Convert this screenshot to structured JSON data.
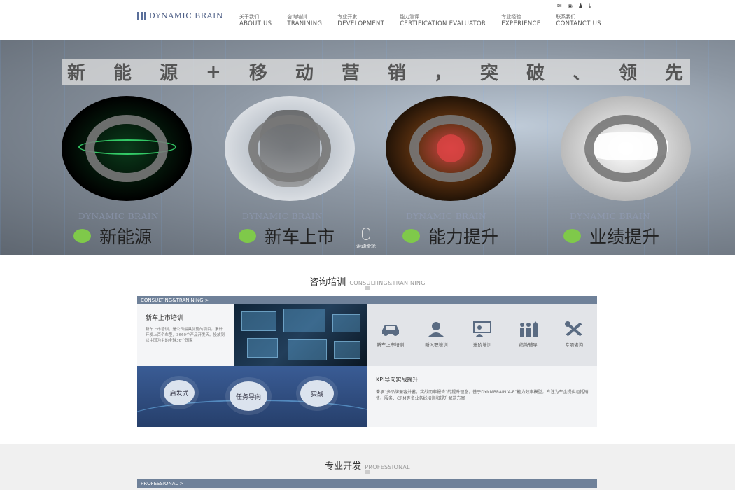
{
  "header": {
    "logo_text": "DYNAMIC BRAIN",
    "nav": [
      {
        "cn": "关于我们",
        "en": "ABOUT US"
      },
      {
        "cn": "咨询培训",
        "en": "TRANINING"
      },
      {
        "cn": "专业开发",
        "en": "DEVELOPMENT"
      },
      {
        "cn": "能力测评",
        "en": "CERTIFICATION EVALUATOR"
      },
      {
        "cn": "专业经验",
        "en": "EXPERIENCE"
      },
      {
        "cn": "联系我们",
        "en": "CONTANCT US"
      }
    ],
    "icons": [
      "wechat-icon",
      "weibo-icon",
      "qq-icon",
      "download-icon"
    ]
  },
  "hero": {
    "slogan": [
      "新",
      "能",
      "源",
      "+",
      "移",
      "动",
      "营",
      "销",
      "，",
      "突",
      "破",
      "、",
      "领",
      "先"
    ],
    "watermark": "DYNAMIC BRAIN",
    "captions": [
      "新能源",
      "新车上市",
      "能力提升",
      "业绩提升"
    ],
    "scroll_label": "滚动滑轮",
    "accent": "#7fc94a"
  },
  "consulting": {
    "title_cn": "咨询培训",
    "title_en": "CONSULTING&TRANINING",
    "bar_label": "CONSULTING&TRANINING >",
    "card_title": "新车上市培训",
    "card_desc": "新车上市培训，是公司最具优势的项目。累计开发上百个车型，3660个产品开发天。投放到以中国为主的全球36个国家",
    "icons": [
      {
        "label": "新车上市培训",
        "icon": "car-icon"
      },
      {
        "label": "新入职培训",
        "icon": "person-icon"
      },
      {
        "label": "进阶培训",
        "icon": "presentation-icon"
      },
      {
        "label": "绩效辅导",
        "icon": "growth-icon"
      },
      {
        "label": "专项咨询",
        "icon": "tools-icon"
      }
    ],
    "bubbles": [
      "启发式",
      "任务导向",
      "实战"
    ],
    "kpi_title": "KPI导向实战提升",
    "kpi_desc": "秉承“多品牌兼容并蓄，实战而非报告”的提升理念，基于DYNMBRAIN“A-P”能力效率模型，专注为车企提供包括销售、服务、CRM等多业务线培训和提升解决方案"
  },
  "professional": {
    "title_cn": "专业开发",
    "title_en": "PROFESSIONAL",
    "bar_label": "PROFESSIONAL >"
  }
}
